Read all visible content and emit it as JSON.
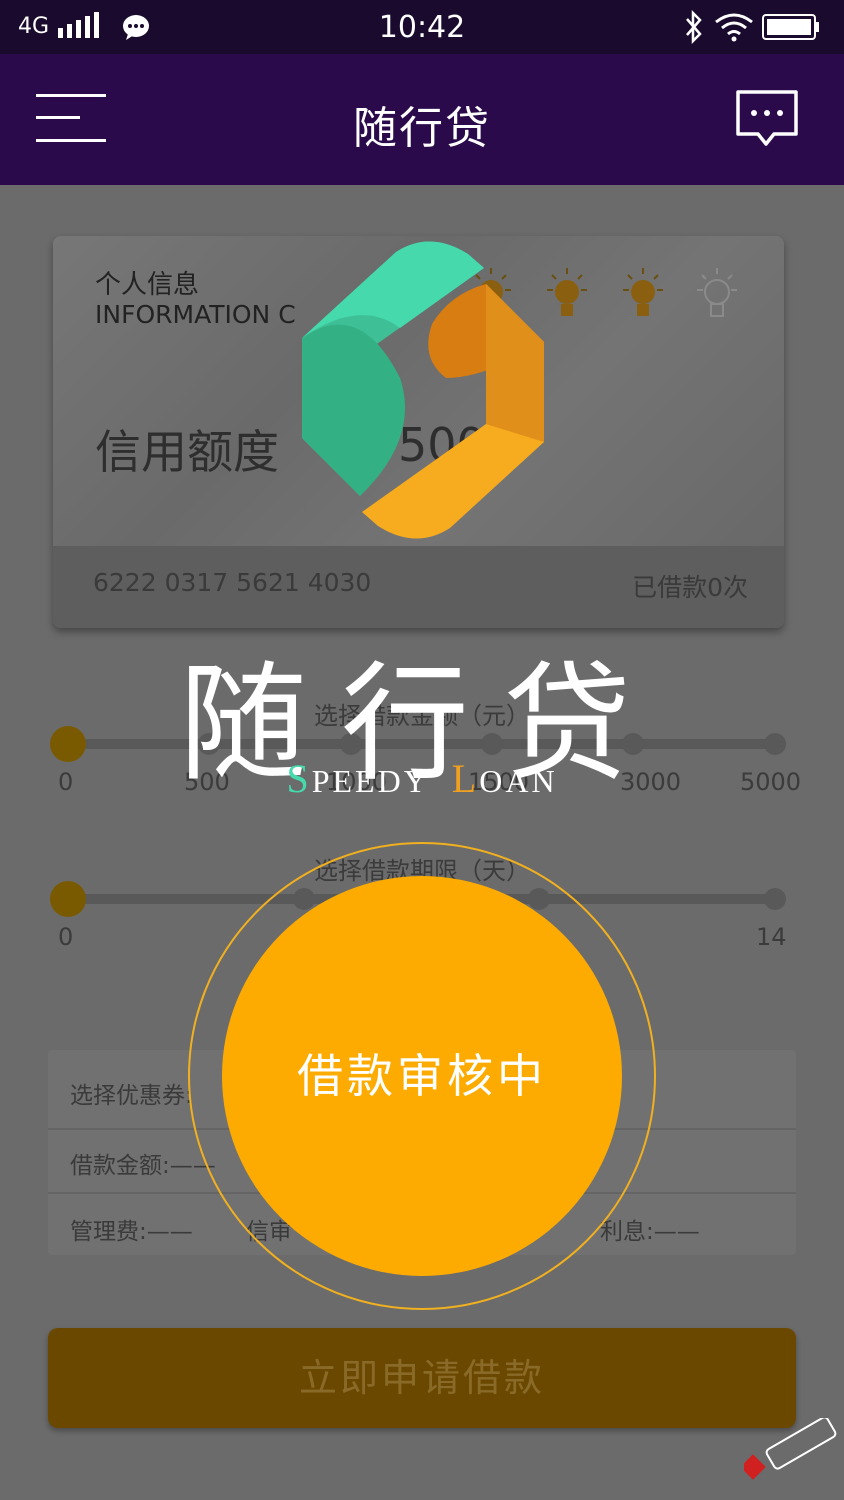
{
  "status": {
    "network": "4G",
    "time": "10:42"
  },
  "appbar": {
    "title": "随行贷"
  },
  "card": {
    "title": "个人信息",
    "subtitle": "INFORMATION C",
    "credit_label": "信用额度",
    "credit_amount": "500",
    "card_number": "6222 0317 5621 4030",
    "loan_count": "已借款0次",
    "level_lit": 3,
    "level_total": 4
  },
  "amount_slider": {
    "label": "选择借款金额（元）",
    "ticks": [
      "0",
      "500",
      "1000",
      "1500",
      "3000",
      "5000"
    ],
    "selected_index": 0
  },
  "term_slider": {
    "label": "选择借款期限（天）",
    "min_label": "0",
    "max_label": "14",
    "selected_index": 0
  },
  "info": {
    "coupon_label": "选择优惠券:",
    "amount_label": "借款金额:——",
    "fee_label": "管理费:——",
    "audit_label": "信审",
    "interest_label": "利息:——"
  },
  "apply_button": "立即申请借款",
  "splash": {
    "brand": "随行贷",
    "brand_en_word1_first": "S",
    "brand_en_word1_rest": "PEEDY",
    "brand_en_word2_first": "L",
    "brand_en_word2_rest": "OAN",
    "status_text": "借款审核中"
  },
  "colors": {
    "statusbar": "#1a0a2e",
    "appbar": "#2a0a4a",
    "accent_orange": "#fdab00",
    "logo_green": "#46d9ac",
    "logo_orange": "#f0a020"
  }
}
